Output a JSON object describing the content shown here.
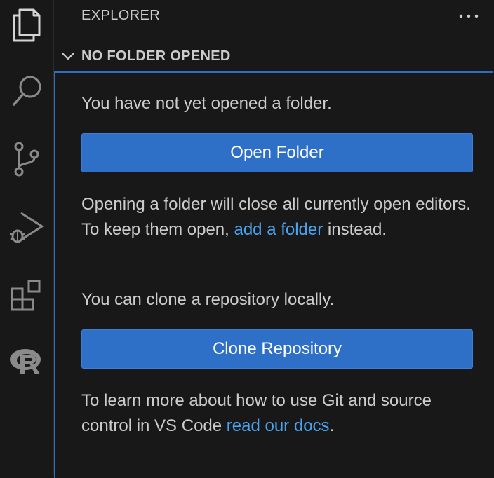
{
  "sidebar": {
    "title": "EXPLORER",
    "more_actions_icon": "ellipsis-icon"
  },
  "activity_bar": {
    "items": [
      {
        "icon": "explorer-files-icon"
      },
      {
        "icon": "search-icon"
      },
      {
        "icon": "source-control-icon"
      },
      {
        "icon": "run-and-debug-icon"
      },
      {
        "icon": "extensions-icon"
      },
      {
        "icon": "r-language-icon"
      }
    ]
  },
  "section": {
    "title": "NO FOLDER OPENED",
    "intro": "You have not yet opened a folder.",
    "open_folder_button": "Open Folder",
    "opening_note_before": "Opening a folder will close all currently open editors. To keep them open, ",
    "opening_note_link": "add a folder",
    "opening_note_after": " instead.",
    "clone_intro": "You can clone a repository locally.",
    "clone_button": "Clone Repository",
    "git_note_before": "To learn more about how to use Git and source control in VS Code ",
    "git_note_link": "read our docs",
    "git_note_after": "."
  },
  "colors": {
    "background": "#181818",
    "button": "#2e6fc7",
    "link": "#4aa3f0",
    "focus_border": "#2e6cc0",
    "text": "#cccccc"
  }
}
